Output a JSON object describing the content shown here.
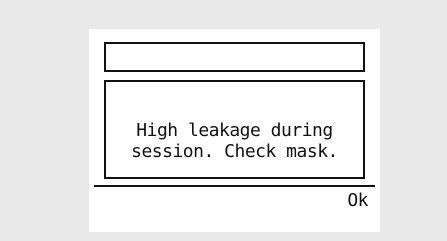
{
  "dialog": {
    "title": "",
    "message_line_1": "High leakage during",
    "message_line_2": "session. Check mask.",
    "ok_label": "Ok"
  },
  "colors": {
    "background": "#e9e9e9",
    "screen": "#ffffff",
    "foreground": "#111111"
  }
}
